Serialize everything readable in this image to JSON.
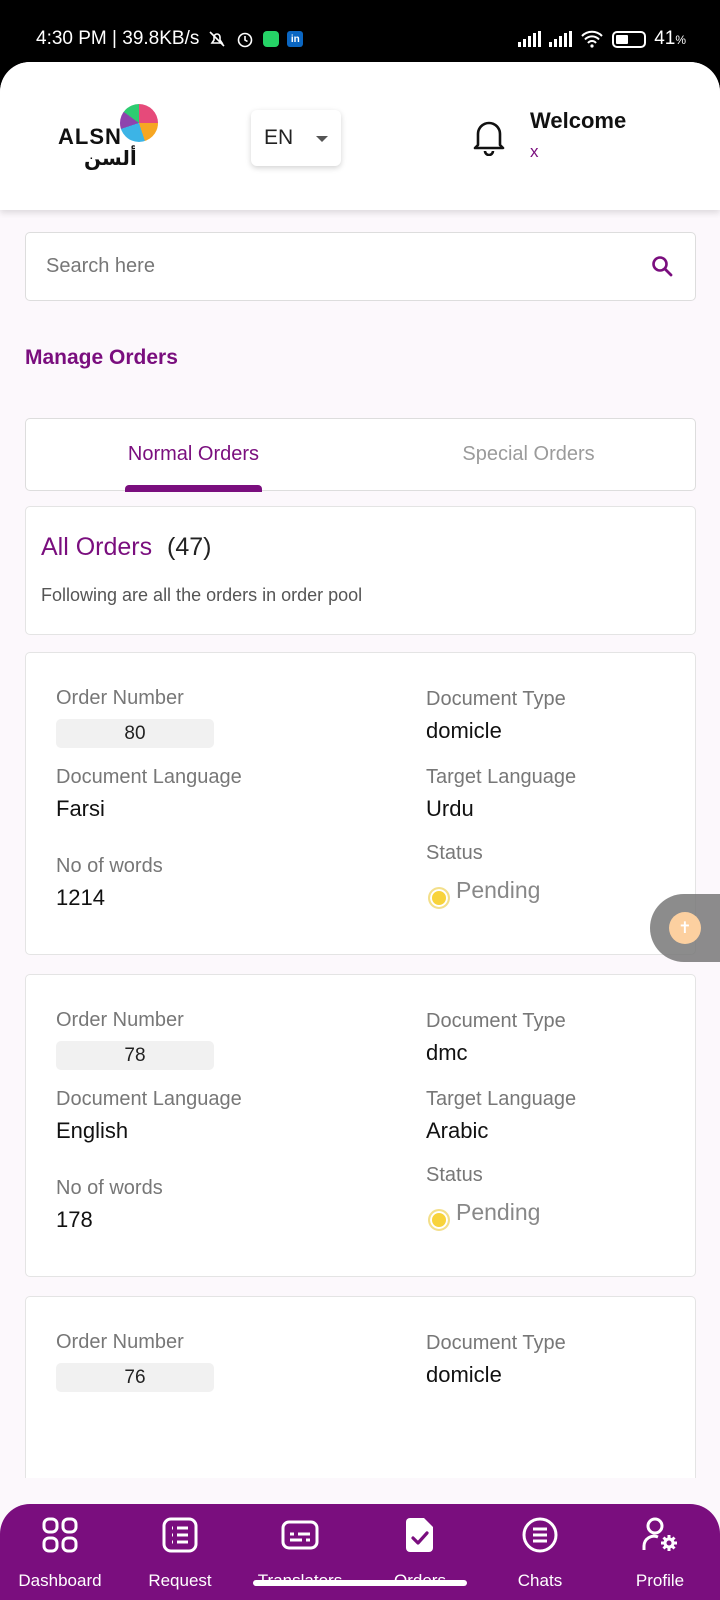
{
  "status_bar": {
    "time_speed": "4:30 PM | 39.8KB/s",
    "battery": "41",
    "battery_unit": "%"
  },
  "header": {
    "logo_text": "ALSN",
    "logo_arabic": "ألسن",
    "language": "EN",
    "welcome": "Welcome",
    "username": "x"
  },
  "search": {
    "placeholder": "Search here"
  },
  "page_title": "Manage Orders",
  "tabs": {
    "normal": "Normal Orders",
    "special": "Special Orders",
    "active": "Normal Orders"
  },
  "summary": {
    "title": "All Orders",
    "count": "(47)",
    "description": "Following are all the orders in order pool"
  },
  "labels": {
    "order_number": "Order Number",
    "document_type": "Document Type",
    "document_language": "Document Language",
    "target_language": "Target Language",
    "words": "No of words",
    "status": "Status"
  },
  "orders": [
    {
      "number": "80",
      "doc_type": "domicle",
      "doc_lang": "Farsi",
      "target_lang": "Urdu",
      "words": "1214",
      "status": "Pending"
    },
    {
      "number": "78",
      "doc_type": "dmc",
      "doc_lang": "English",
      "target_lang": "Arabic",
      "words": "178",
      "status": "Pending"
    },
    {
      "number": "76",
      "doc_type": "domicle",
      "doc_lang": "",
      "target_lang": "",
      "words": "",
      "status": ""
    }
  ],
  "colors": {
    "brand": "#7a0e7e",
    "status_pending": "#f8d33b"
  },
  "nav": [
    {
      "label": "Dashboard",
      "icon": "grid-icon"
    },
    {
      "label": "Request",
      "icon": "list-icon"
    },
    {
      "label": "Translators",
      "icon": "subtitles-icon"
    },
    {
      "label": "Orders",
      "icon": "document-check-icon"
    },
    {
      "label": "Chats",
      "icon": "chat-icon"
    },
    {
      "label": "Profile",
      "icon": "user-settings-icon"
    }
  ]
}
